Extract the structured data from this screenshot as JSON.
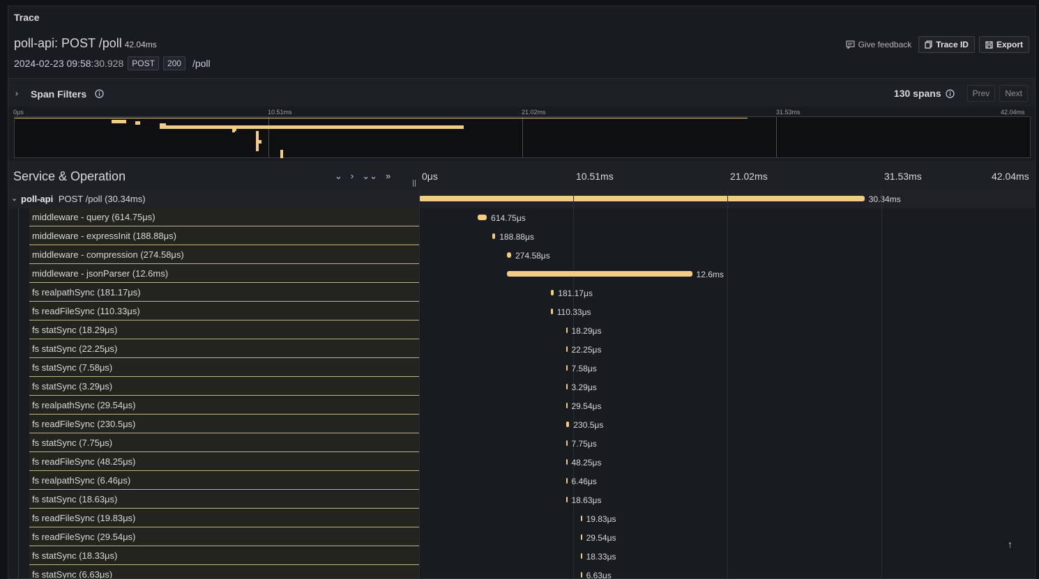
{
  "panel": {
    "title": "Trace"
  },
  "trace": {
    "name": "poll-api: POST /poll",
    "duration": "42.04ms",
    "date": "2024-02-23 09:58:",
    "time": "30.928",
    "method": "POST",
    "status": "200",
    "url": "/poll"
  },
  "toolbar": {
    "feedback_label": "Give feedback",
    "trace_id_label": "Trace ID",
    "export_label": "Export"
  },
  "filters": {
    "label": "Span Filters",
    "span_count": "130 spans",
    "prev_label": "Prev",
    "next_label": "Next"
  },
  "minimap": {
    "ticks": [
      "0μs",
      "10.51ms",
      "21.02ms",
      "31.53ms",
      "42.04ms"
    ]
  },
  "header": {
    "title": "Service & Operation",
    "ticks": [
      "0μs",
      "10.51ms",
      "21.02ms",
      "31.53ms",
      "42.04ms"
    ]
  },
  "root_span": {
    "service": "poll-api",
    "operation": "POST /poll (30.34ms)",
    "duration_label": "30.34ms",
    "start_ms": 0,
    "duration_ms": 30.34
  },
  "spans": [
    {
      "label": "middleware - query (614.75μs)",
      "duration_label": "614.75μs",
      "start_ms": 4.0,
      "duration_ms": 0.615
    },
    {
      "label": "middleware - expressInit (188.88μs)",
      "duration_label": "188.88μs",
      "start_ms": 5.0,
      "duration_ms": 0.189
    },
    {
      "label": "middleware - compression (274.58μs)",
      "duration_label": "274.58μs",
      "start_ms": 6.0,
      "duration_ms": 0.275
    },
    {
      "label": "middleware - jsonParser (12.6ms)",
      "duration_label": "12.6ms",
      "start_ms": 6.0,
      "duration_ms": 12.6
    },
    {
      "label": "fs realpathSync (181.17μs)",
      "duration_label": "181.17μs",
      "start_ms": 9.0,
      "duration_ms": 0.181
    },
    {
      "label": "fs readFileSync (110.33μs)",
      "duration_label": "110.33μs",
      "start_ms": 9.0,
      "duration_ms": 0.11
    },
    {
      "label": "fs statSync (18.29μs)",
      "duration_label": "18.29μs",
      "start_ms": 10.0,
      "duration_ms": 0.018
    },
    {
      "label": "fs statSync (22.25μs)",
      "duration_label": "22.25μs",
      "start_ms": 10.0,
      "duration_ms": 0.022
    },
    {
      "label": "fs statSync (7.58μs)",
      "duration_label": "7.58μs",
      "start_ms": 10.0,
      "duration_ms": 0.008
    },
    {
      "label": "fs statSync (3.29μs)",
      "duration_label": "3.29μs",
      "start_ms": 10.0,
      "duration_ms": 0.003
    },
    {
      "label": "fs realpathSync (29.54μs)",
      "duration_label": "29.54μs",
      "start_ms": 10.0,
      "duration_ms": 0.03
    },
    {
      "label": "fs readFileSync (230.5μs)",
      "duration_label": "230.5μs",
      "start_ms": 10.0,
      "duration_ms": 0.231
    },
    {
      "label": "fs statSync (7.75μs)",
      "duration_label": "7.75μs",
      "start_ms": 10.0,
      "duration_ms": 0.008
    },
    {
      "label": "fs readFileSync (48.25μs)",
      "duration_label": "48.25μs",
      "start_ms": 10.0,
      "duration_ms": 0.048
    },
    {
      "label": "fs realpathSync (6.46μs)",
      "duration_label": "6.46μs",
      "start_ms": 10.0,
      "duration_ms": 0.006
    },
    {
      "label": "fs statSync (18.63μs)",
      "duration_label": "18.63μs",
      "start_ms": 10.0,
      "duration_ms": 0.019
    },
    {
      "label": "fs readFileSync (19.83μs)",
      "duration_label": "19.83μs",
      "start_ms": 11.0,
      "duration_ms": 0.02
    },
    {
      "label": "fs readFileSync (29.54μs)",
      "duration_label": "29.54μs",
      "start_ms": 11.0,
      "duration_ms": 0.03
    },
    {
      "label": "fs statSync (18.33μs)",
      "duration_label": "18.33μs",
      "start_ms": 11.0,
      "duration_ms": 0.018
    },
    {
      "label": "fs statSync (6.63μs)",
      "duration_label": "6.63μs",
      "start_ms": 11.0,
      "duration_ms": 0.007
    }
  ],
  "colors": {
    "span_bar": "#f2cc87",
    "background": "#181b1f"
  }
}
